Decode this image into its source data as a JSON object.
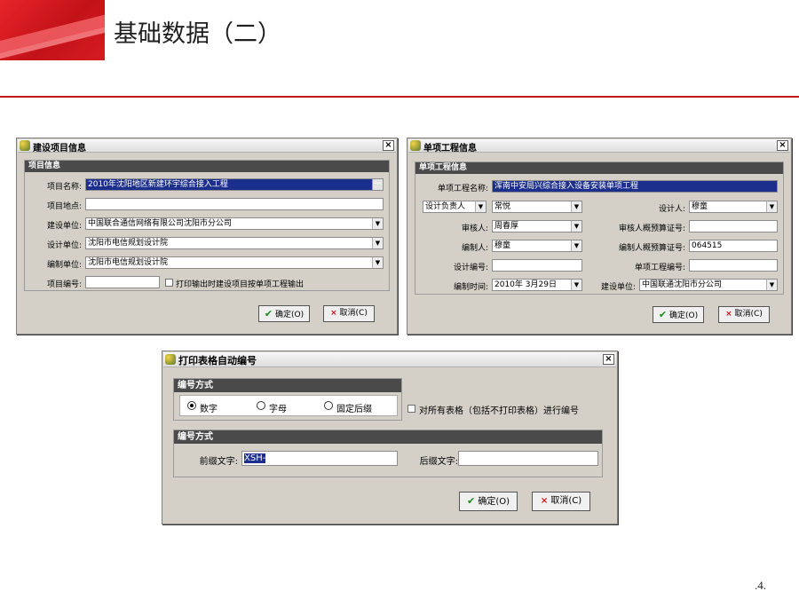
{
  "slide": {
    "title": "基础数据（二）",
    "page_number": ".4."
  },
  "dialog1": {
    "title": "建设项目信息",
    "group_title": "项目信息",
    "labels": {
      "name": "项目名称:",
      "location": "项目地点:",
      "builder": "建设单位:",
      "designer": "设计单位:",
      "editor": "编制单位:",
      "number": "项目编号:"
    },
    "values": {
      "name": "2010年沈阳地区新建环宇综合接入工程",
      "location": "",
      "builder": "中国联合通信网络有限公司沈阳市分公司",
      "designer": "沈阳市电信规划设计院",
      "editor": "沈阳市电信规划设计院",
      "number": ""
    },
    "checkbox_label": "打印输出时建设项目按单项工程输出",
    "ok_label": "确定(O)",
    "cancel_label": "取消(C)"
  },
  "dialog2": {
    "title": "单项工程信息",
    "group_title": "单项工程信息",
    "labels": {
      "name": "单项工程名称:",
      "owner_select": "设计负责人",
      "reviewer": "审核人:",
      "compiler": "编制人:",
      "design_no": "设计编号:",
      "compile_time": "编制时间:",
      "designer": "设计人:",
      "reviewer_cert": "审核人概预算证号:",
      "compiler_cert": "编制人概预算证号:",
      "project_no": "单项工程编号:",
      "builder": "建设单位:"
    },
    "values": {
      "name": "浑南中安局兴综合接入设备安装单项工程",
      "owner": "常悦",
      "reviewer": "周春厚",
      "compiler": "穆童",
      "design_no": "",
      "compile_time": "2010年 3月29日",
      "designer": "穆童",
      "reviewer_cert": "",
      "compiler_cert": "064515",
      "project_no": "",
      "builder": "中国联通沈阳市分公司"
    },
    "ok_label": "确定(O)",
    "cancel_label": "取消(C)"
  },
  "dialog3": {
    "title": "打印表格自动编号",
    "group1_title": "编号方式",
    "radio_options": [
      "数字",
      "字母",
      "固定后缀"
    ],
    "selected_radio": "数字",
    "checkbox_label": "对所有表格（包括不打印表格）进行编号",
    "group2_title": "编号方式",
    "prefix_label": "前缀文字:",
    "prefix_value": "XSH-",
    "suffix_label": "后缀文字:",
    "suffix_value": "",
    "ok_label": "确定(O)",
    "cancel_label": "取消(C)"
  }
}
